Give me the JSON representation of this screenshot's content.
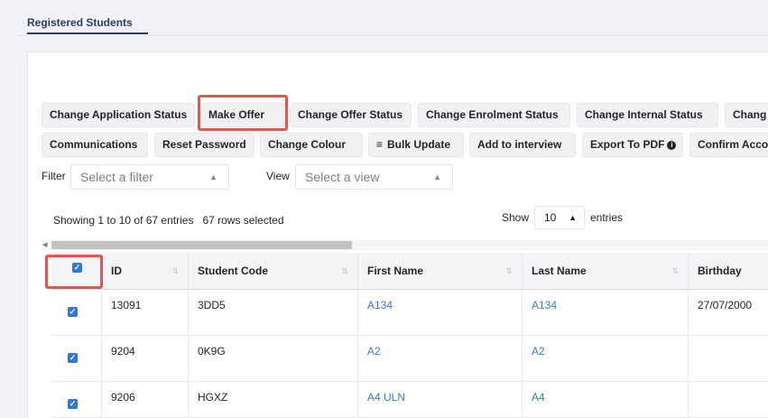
{
  "tabs": {
    "active": "Registered Students"
  },
  "action_buttons_row1": [
    {
      "label": "Change Application Status"
    },
    {
      "label": "Make Offer"
    },
    {
      "label": "Change Offer Status"
    },
    {
      "label": "Change Enrolment Status"
    },
    {
      "label": "Change Internal Status"
    },
    {
      "label": "Chang"
    }
  ],
  "action_buttons_row2": [
    {
      "label": "Communications"
    },
    {
      "label": "Reset Password"
    },
    {
      "label": "Change Colour"
    },
    {
      "label": "Bulk Update",
      "icon": "list-icon"
    },
    {
      "label": "Add to interview"
    },
    {
      "label": "Export To PDF",
      "icon": "info-icon"
    },
    {
      "label": "Confirm Acco"
    }
  ],
  "filter": {
    "label": "Filter",
    "placeholder": "Select a filter"
  },
  "view": {
    "label": "View",
    "placeholder": "Select a view"
  },
  "table_info": {
    "entries_text": "Showing 1 to 10 of 67 entries",
    "selected_text": "67 rows selected"
  },
  "page_length": {
    "show_label": "Show",
    "value": "10",
    "entries_label": "entries"
  },
  "columns": [
    "ID",
    "Student Code",
    "First Name",
    "Last Name",
    "Birthday"
  ],
  "rows": [
    {
      "id": "13091",
      "student_code": "3DD5",
      "first_name": "A134",
      "last_name": "A134",
      "birthday": "27/07/2000"
    },
    {
      "id": "9204",
      "student_code": "0K9G",
      "first_name": "A2",
      "last_name": "A2",
      "birthday": ""
    },
    {
      "id": "9206",
      "student_code": "HGXZ",
      "first_name": "A4 ULN",
      "last_name": "A4",
      "birthday": ""
    }
  ],
  "colors": {
    "highlight": "#e0584a",
    "checkbox": "#2f78d6",
    "link": "#3679c4",
    "tab": "#2f3b63"
  }
}
